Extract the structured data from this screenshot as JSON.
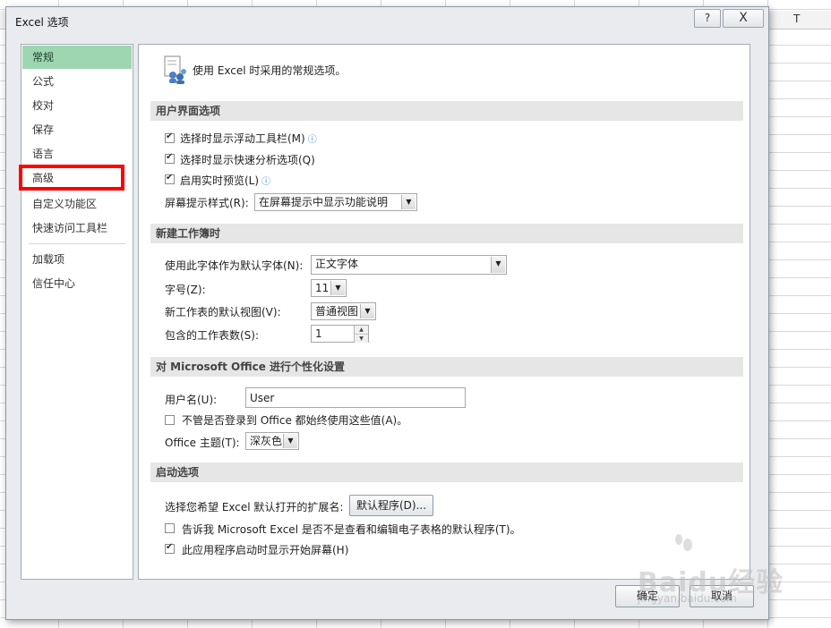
{
  "sheet": {
    "column_letter": "T"
  },
  "dialog": {
    "title": "Excel 选项",
    "help_label": "?",
    "close_label": "X",
    "ok_label": "确定",
    "cancel_label": "取消"
  },
  "nav": {
    "items": [
      {
        "label": "常规"
      },
      {
        "label": "公式"
      },
      {
        "label": "校对"
      },
      {
        "label": "保存"
      },
      {
        "label": "语言"
      },
      {
        "label": "高级"
      },
      {
        "label": "自定义功能区"
      },
      {
        "label": "快速访问工具栏"
      },
      {
        "label": "加载项"
      },
      {
        "label": "信任中心"
      }
    ],
    "active_index": 0,
    "highlighted_index": 5
  },
  "content": {
    "intro": "使用 Excel 时采用的常规选项。",
    "ui_section": {
      "header": "用户界面选项",
      "opt_mini_toolbar": "选择时显示浮动工具栏(M)",
      "opt_quick_analysis": "选择时显示快速分析选项(Q)",
      "opt_live_preview": "启用实时预览(L)",
      "screentip_label": "屏幕提示样式(R):",
      "screentip_value": "在屏幕提示中显示功能说明"
    },
    "workbook_section": {
      "header": "新建工作簿时",
      "font_label": "使用此字体作为默认字体(N):",
      "font_value": "正文字体",
      "size_label": "字号(Z):",
      "size_value": "11",
      "view_label": "新工作表的默认视图(V):",
      "view_value": "普通视图",
      "sheets_label": "包含的工作表数(S):",
      "sheets_value": "1"
    },
    "personalize_section": {
      "header": "对 Microsoft Office 进行个性化设置",
      "username_label": "用户名(U):",
      "username_value": "User",
      "always_use": "不管是否登录到 Office 都始终使用这些值(A)。",
      "theme_label": "Office 主题(T):",
      "theme_value": "深灰色"
    },
    "startup_section": {
      "header": "启动选项",
      "ext_label": "选择您希望 Excel 默认打开的扩展名:",
      "default_programs_button": "默认程序(D)...",
      "tell_me": "告诉我 Microsoft Excel 是否不是查看和编辑电子表格的默认程序(T)。",
      "show_start": "此应用程序启动时显示开始屏幕(H)"
    }
  },
  "watermark": {
    "text": "Baidu经验",
    "sub": "jingyan.baidu.com"
  },
  "colors": {
    "active_nav": "#9fd6b2",
    "highlight_box": "#ff0000",
    "section_header_bg": "#e6e6e6",
    "dialog_bg": "#e9ebee"
  }
}
